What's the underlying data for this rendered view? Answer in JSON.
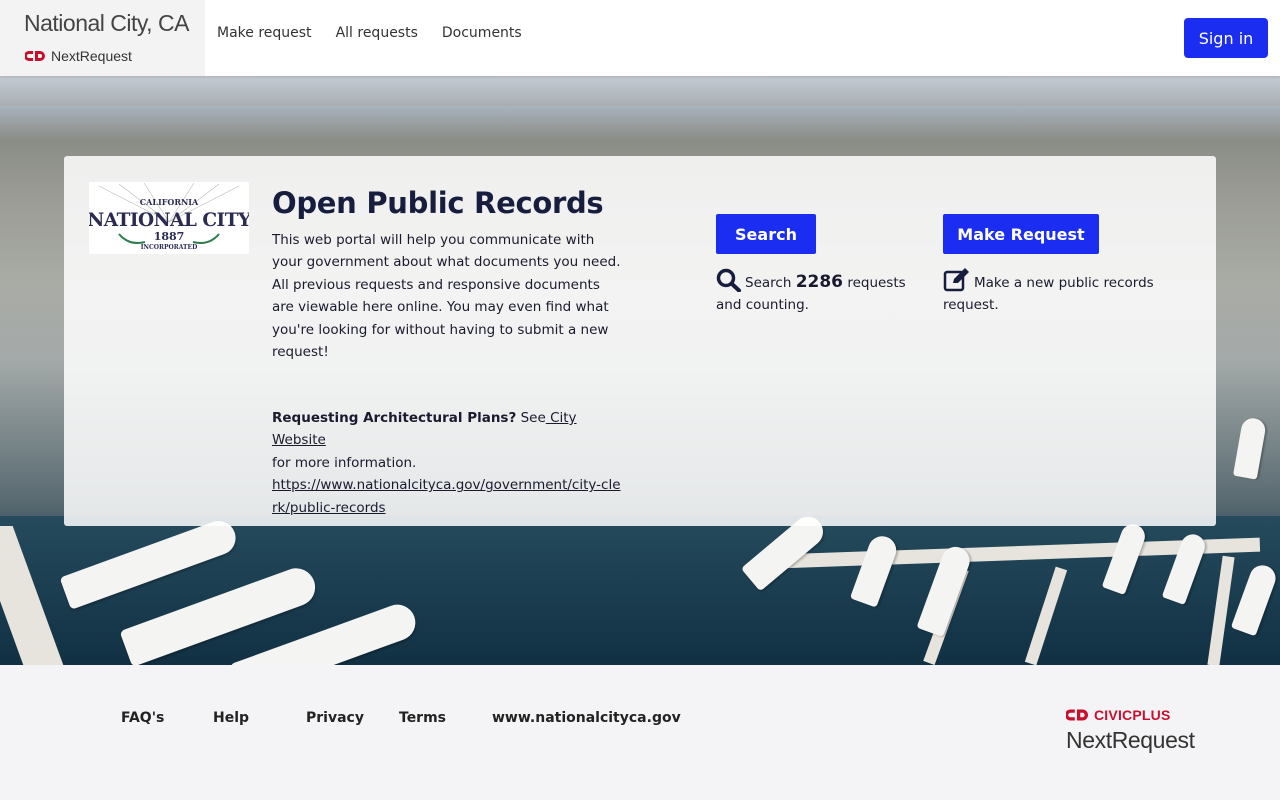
{
  "header": {
    "brand_title": "National City, CA",
    "brand_sub": "NextRequest",
    "nav": [
      "Make request",
      "All requests",
      "Documents"
    ],
    "signin_label": "Sign in"
  },
  "card": {
    "seal_text": {
      "top": "CALIFORNIA",
      "name": "NATIONAL CITY",
      "year": "1887",
      "bottom": "INCORPORATED"
    },
    "title": "Open Public Records",
    "intro": "This web portal will help you communicate with your government about what documents you need. All previous requests and responsive documents are viewable here online. You may even find what you're looking for without having to submit a new request!",
    "arch_bold": "Requesting Architectural Plans?",
    "arch_see": " See",
    "arch_link": " City Website",
    "arch_more": "for more information.",
    "arch_url": "https://www.nationalcityca.gov/government/city-clerk/public-records",
    "search_button": "Search",
    "request_button": "Make Request",
    "search_prefix": "Search",
    "search_count": "2286",
    "search_suffix": "requests and counting.",
    "request_blurb": "Make a new public records request."
  },
  "footer": {
    "links": [
      "FAQ's",
      "Help",
      "Privacy",
      "Terms",
      "www.nationalcityca.gov"
    ],
    "civicplus": "CIVICPLUS",
    "nextrequest": "NextRequest"
  },
  "colors": {
    "primary": "#1c2df2",
    "title": "#171d3d",
    "civicplus_red": "#c8102e"
  },
  "icons": {
    "search": "search-icon",
    "edit": "edit-icon",
    "civicplus": "civicplus-logo-icon"
  }
}
